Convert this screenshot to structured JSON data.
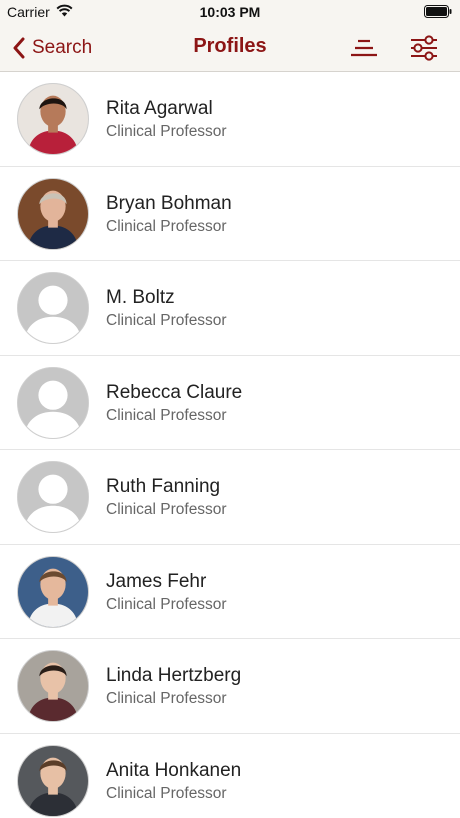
{
  "status_bar": {
    "carrier": "Carrier",
    "time": "10:03 PM"
  },
  "nav": {
    "back_label": "Search",
    "title": "Profiles",
    "accent_color": "#8c1515"
  },
  "profiles": [
    {
      "name": "Rita Agarwal",
      "title": "Clinical Professor",
      "photo": "photo",
      "palette": {
        "bg": "#e9e4df",
        "skin": "#b67a5a",
        "hair": "#1d1410",
        "clothing": "#b8203a"
      }
    },
    {
      "name": "Bryan Bohman",
      "title": "Clinical Professor",
      "photo": "photo",
      "palette": {
        "bg": "#7a4a2c",
        "skin": "#e2b49a",
        "hair": "#c9c2b6",
        "clothing": "#1e2a45"
      }
    },
    {
      "name": "M. Boltz",
      "title": "Clinical Professor",
      "photo": "placeholder"
    },
    {
      "name": "Rebecca Claure",
      "title": "Clinical Professor",
      "photo": "placeholder"
    },
    {
      "name": "Ruth Fanning",
      "title": "Clinical Professor",
      "photo": "placeholder"
    },
    {
      "name": "James Fehr",
      "title": "Clinical Professor",
      "photo": "photo",
      "palette": {
        "bg": "#3d5f8a",
        "skin": "#e5b89c",
        "hair": "#6b4a30",
        "clothing": "#f2f2f2"
      }
    },
    {
      "name": "Linda Hertzberg",
      "title": "Clinical Professor",
      "photo": "photo",
      "palette": {
        "bg": "#a8a39c",
        "skin": "#e8c2a8",
        "hair": "#2a1e18",
        "clothing": "#5a2a2f"
      }
    },
    {
      "name": "Anita Honkanen",
      "title": "Clinical Professor",
      "photo": "photo",
      "palette": {
        "bg": "#55585c",
        "skin": "#e7c0a5",
        "hair": "#5a3d28",
        "clothing": "#2c2f36"
      }
    }
  ]
}
